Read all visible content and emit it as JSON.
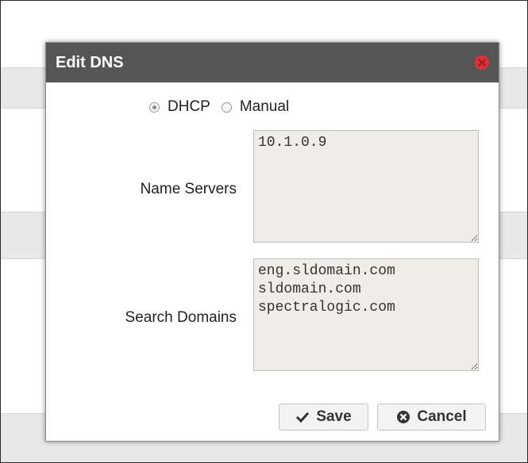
{
  "dialog": {
    "title": "Edit DNS",
    "mode": {
      "options": [
        {
          "label": "DHCP",
          "checked": true
        },
        {
          "label": "Manual",
          "checked": false
        }
      ]
    },
    "name_servers": {
      "label": "Name Servers",
      "value": "10.1.0.9"
    },
    "search_domains": {
      "label": "Search Domains",
      "value": "eng.sldomain.com\nsldomain.com\nspectralogic.com"
    },
    "buttons": {
      "save": "Save",
      "cancel": "Cancel"
    }
  },
  "icons": {
    "close": "close-icon",
    "save": "check-icon",
    "cancel": "cancel-circle-icon"
  },
  "colors": {
    "titlebar": "#555555",
    "close": "#e0313a",
    "textarea_bg": "#efede6"
  }
}
